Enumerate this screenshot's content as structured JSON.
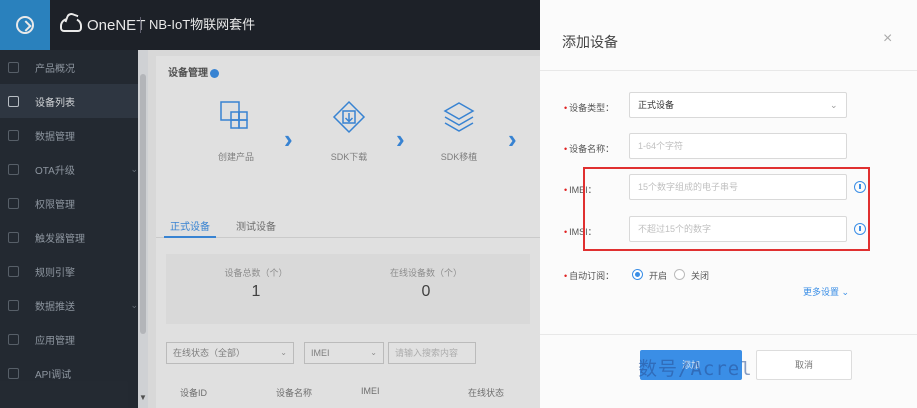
{
  "topbar": {
    "brand": "OneNET",
    "app_title": "NB-IoT物联网套件"
  },
  "sidebar": {
    "items": [
      {
        "label": "产品概况",
        "icon": "home-icon"
      },
      {
        "label": "设备列表",
        "icon": "list-icon",
        "active": true
      },
      {
        "label": "数据管理",
        "icon": "grid-icon"
      },
      {
        "label": "OTA升级",
        "icon": "upgrade-icon",
        "expandable": true
      },
      {
        "label": "权限管理",
        "icon": "key-icon"
      },
      {
        "label": "触发器管理",
        "icon": "trigger-icon"
      },
      {
        "label": "规则引擎",
        "icon": "rule-icon"
      },
      {
        "label": "数据推送",
        "icon": "push-icon",
        "expandable": true
      },
      {
        "label": "应用管理",
        "icon": "app-icon"
      },
      {
        "label": "API调试",
        "icon": "api-icon"
      }
    ]
  },
  "main": {
    "section_title": "设备管理",
    "steps": [
      "创建产品",
      "SDK下载",
      "SDK移植"
    ],
    "tabs": [
      "正式设备",
      "测试设备"
    ],
    "stats": [
      {
        "label": "设备总数（个）",
        "value": "1"
      },
      {
        "label": "在线设备数（个）",
        "value": "0"
      }
    ],
    "filters": {
      "status": "在线状态（全部）",
      "type": "IMEI",
      "search_placeholder": "请输入搜索内容"
    },
    "table_headers": [
      "设备ID",
      "设备名称",
      "IMEI",
      "在线状态"
    ]
  },
  "modal": {
    "title": "添加设备",
    "close": "×",
    "fields": {
      "device_type": {
        "label": "设备类型：",
        "value": "正式设备"
      },
      "device_name": {
        "label": "设备名称：",
        "placeholder": "1-64个字符"
      },
      "imei": {
        "label": "IMEI：",
        "placeholder": "15个数字组成的电子串号"
      },
      "imsi": {
        "label": "IMSI：",
        "placeholder": "不超过15个的数字"
      }
    },
    "auto_subscribe": {
      "label": "自动订阅：",
      "options": [
        "开启",
        "关闭"
      ],
      "selected": "开启"
    },
    "more_settings": "更多设置 ⌄",
    "buttons": {
      "confirm": "添加",
      "cancel": "取消"
    },
    "watermark": "数号/Acrel"
  },
  "colors": {
    "accent": "#3a8ee6",
    "highlight_border": "#e03030",
    "topbar": "#1c2129",
    "sidebar": "#232a33"
  }
}
